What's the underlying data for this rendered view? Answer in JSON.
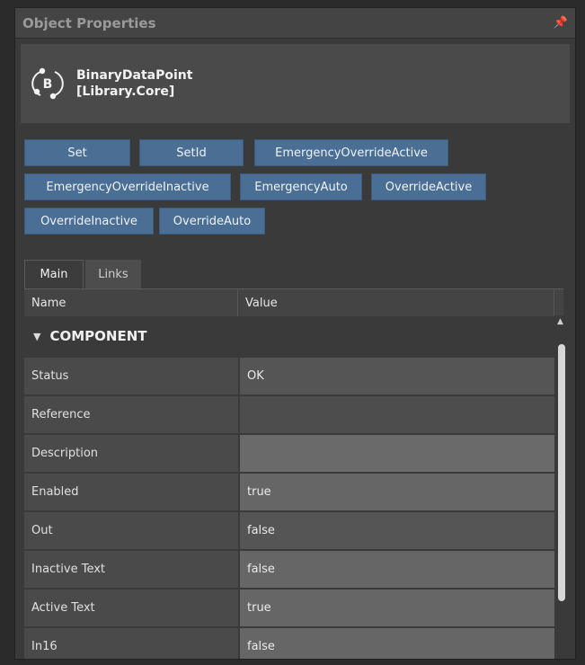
{
  "panel": {
    "title": "Object Properties",
    "pin_icon": "pin-icon"
  },
  "object": {
    "icon": "binary-data-point-icon",
    "icon_letter": "B",
    "name_line1": "BinaryDataPoint",
    "name_line2": "[Library.Core]"
  },
  "actions": [
    "Set",
    "SetId",
    "EmergencyOverrideActive",
    "EmergencyOverrideInactive",
    "EmergencyAuto",
    "OverrideActive",
    "OverrideInactive",
    "OverrideAuto"
  ],
  "tabs": [
    {
      "label": "Main",
      "active": true
    },
    {
      "label": "Links",
      "active": false
    }
  ],
  "grid": {
    "columns": [
      "Name",
      "Value"
    ],
    "group": "COMPONENT",
    "rows": [
      {
        "name": "Status",
        "value": "OK"
      },
      {
        "name": "Reference",
        "value": ""
      },
      {
        "name": "Description",
        "value": ""
      },
      {
        "name": "Enabled",
        "value": "true"
      },
      {
        "name": "Out",
        "value": "false"
      },
      {
        "name": "Inactive Text",
        "value": "false"
      },
      {
        "name": "Active Text",
        "value": "true"
      },
      {
        "name": "In16",
        "value": "false"
      }
    ]
  },
  "colors": {
    "button_bg": "#4b6e94",
    "panel_bg": "#3a3a3a"
  }
}
